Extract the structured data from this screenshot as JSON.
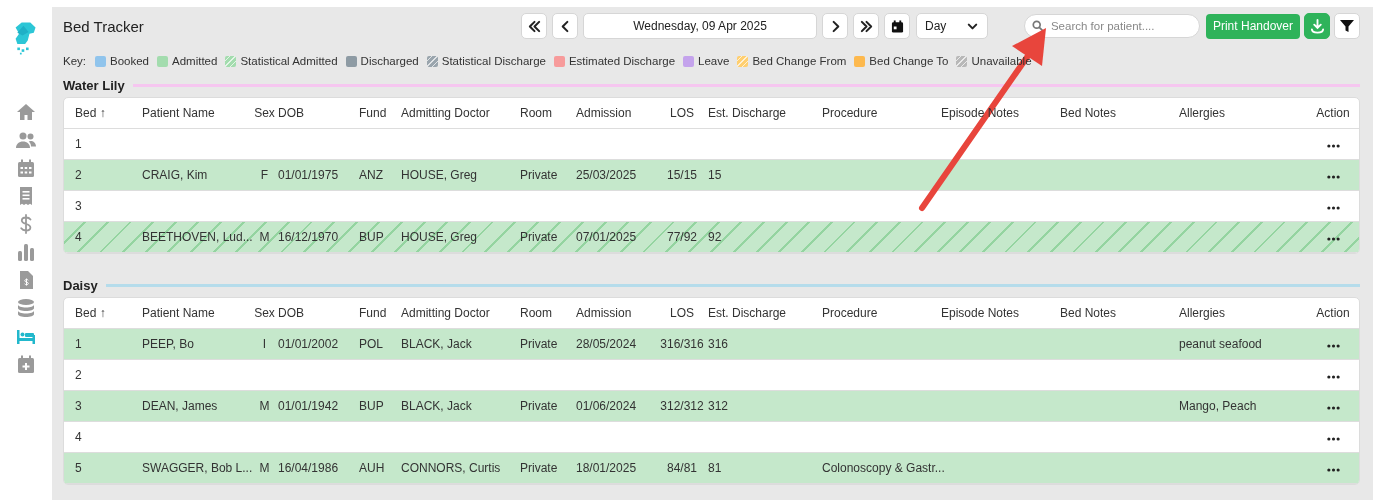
{
  "sidebar": {
    "items": [
      {
        "selected": false
      },
      {
        "selected": false
      },
      {
        "selected": false
      },
      {
        "selected": false
      },
      {
        "selected": false
      },
      {
        "selected": false
      },
      {
        "selected": false
      },
      {
        "selected": false
      },
      {
        "selected": true
      },
      {
        "selected": false
      }
    ]
  },
  "header": {
    "title": "Bed Tracker",
    "date": "Wednesday, 09 Apr 2025",
    "view": "Day",
    "search": {
      "placeholder": "Search for patient...."
    },
    "print_button": "Print Handover"
  },
  "key": {
    "label": "Key:",
    "items": [
      {
        "label": "Booked",
        "color": "#90c4ec",
        "kind": "solid"
      },
      {
        "label": "Admitted",
        "color": "#a3dcae",
        "kind": "solid"
      },
      {
        "label": "Statistical Admitted",
        "color": "#a3dcae",
        "kind": "hatched"
      },
      {
        "label": "Discharged",
        "color": "#8e9ba4",
        "kind": "solid"
      },
      {
        "label": "Statistical Discharge",
        "color": "#9aa5ad",
        "kind": "hatched"
      },
      {
        "label": "Estimated Discharge",
        "color": "#f79b9b",
        "kind": "solid"
      },
      {
        "label": "Leave",
        "color": "#c4a3ec",
        "kind": "solid"
      },
      {
        "label": "Bed Change From",
        "color": "#ffcf70",
        "kind": "hatched"
      },
      {
        "label": "Bed Change To",
        "color": "#fdb94e",
        "kind": "solid"
      },
      {
        "label": "Unavailable",
        "color": "#b8b8b8",
        "kind": "hatched"
      }
    ]
  },
  "wards": [
    {
      "name": "Water Lily",
      "color": "#f6c6f0",
      "columns": [
        "Bed ↑",
        "Patient Name",
        "Sex",
        "DOB",
        "Fund",
        "Admitting Doctor",
        "Room",
        "Admission",
        "LOS",
        "Est. Discharge",
        "Procedure",
        "Episode Notes",
        "Bed Notes",
        "Allergies",
        "Action"
      ],
      "rows": [
        {
          "kind": "empty",
          "bed": "1"
        },
        {
          "kind": "admitted",
          "bed": "2",
          "patient": "CRAIG, Kim",
          "sex": "F",
          "dob": "01/01/1975",
          "fund": "ANZ",
          "doctor": "HOUSE, Greg",
          "room": "Private",
          "admission": "25/03/2025",
          "los": "15/15",
          "est": "15"
        },
        {
          "kind": "empty",
          "bed": "3"
        },
        {
          "kind": "statistical_admitted",
          "bed": "4",
          "patient": "BEETHOVEN, Lud...",
          "sex": "M",
          "dob": "16/12/1970",
          "fund": "BUP",
          "doctor": "HOUSE, Greg",
          "room": "Private",
          "admission": "07/01/2025",
          "los": "77/92",
          "est": "92"
        }
      ]
    },
    {
      "name": "Daisy",
      "color": "#b5dceb",
      "columns": [
        "Bed ↑",
        "Patient Name",
        "Sex",
        "DOB",
        "Fund",
        "Admitting Doctor",
        "Room",
        "Admission",
        "LOS",
        "Est. Discharge",
        "Procedure",
        "Episode Notes",
        "Bed Notes",
        "Allergies",
        "Action"
      ],
      "rows": [
        {
          "kind": "admitted",
          "bed": "1",
          "patient": "PEEP, Bo",
          "sex": "I",
          "dob": "01/01/2002",
          "fund": "POL",
          "doctor": "BLACK, Jack",
          "room": "Private",
          "admission": "28/05/2024",
          "los": "316/316",
          "est": "316",
          "allergies": "peanut seafood"
        },
        {
          "kind": "empty",
          "bed": "2"
        },
        {
          "kind": "admitted",
          "bed": "3",
          "patient": "DEAN, James",
          "sex": "M",
          "dob": "01/01/1942",
          "fund": "BUP",
          "doctor": "BLACK, Jack",
          "room": "Private",
          "admission": "01/06/2024",
          "los": "312/312",
          "est": "312",
          "allergies": "Mango, Peach"
        },
        {
          "kind": "empty",
          "bed": "4"
        },
        {
          "kind": "admitted",
          "bed": "5",
          "patient": "SWAGGER, Bob L...",
          "sex": "M",
          "dob": "16/04/1986",
          "fund": "AUH",
          "doctor": "CONNORS, Curtis",
          "room": "Private",
          "admission": "18/01/2025",
          "los": "84/81",
          "est": "81",
          "procedure": "Colonoscopy & Gastr..."
        }
      ]
    }
  ]
}
